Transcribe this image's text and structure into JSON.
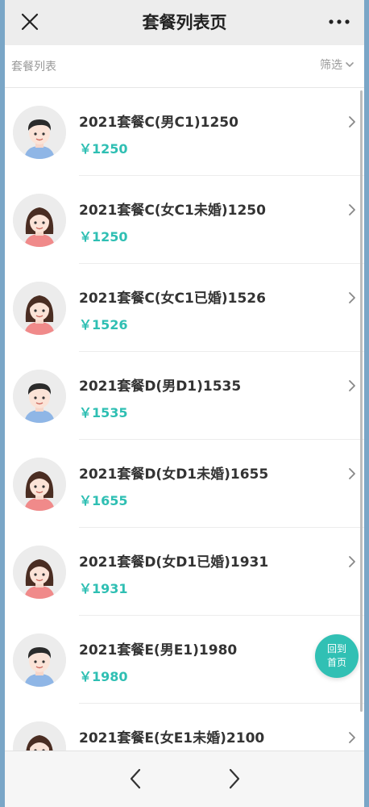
{
  "header": {
    "title": "套餐列表页"
  },
  "filterbar": {
    "label": "套餐列表",
    "filter_label": "筛选"
  },
  "items": [
    {
      "name": "2021套餐C(男C1)1250",
      "price": "￥1250",
      "gender": "male"
    },
    {
      "name": "2021套餐C(女C1未婚)1250",
      "price": "￥1250",
      "gender": "female"
    },
    {
      "name": "2021套餐C(女C1已婚)1526",
      "price": "￥1526",
      "gender": "female"
    },
    {
      "name": "2021套餐D(男D1)1535",
      "price": "￥1535",
      "gender": "male"
    },
    {
      "name": "2021套餐D(女D1未婚)1655",
      "price": "￥1655",
      "gender": "female"
    },
    {
      "name": "2021套餐D(女D1已婚)1931",
      "price": "￥1931",
      "gender": "female"
    },
    {
      "name": "2021套餐E(男E1)1980",
      "price": "￥1980",
      "gender": "male"
    },
    {
      "name": "2021套餐E(女E1未婚)2100",
      "price": "",
      "gender": "female"
    }
  ],
  "home_button": {
    "line1": "回到",
    "line2": "首页"
  },
  "colors": {
    "accent": "#2fbfb3",
    "home_button": "#31c0b4",
    "page_bg": "#7aa6c7"
  }
}
